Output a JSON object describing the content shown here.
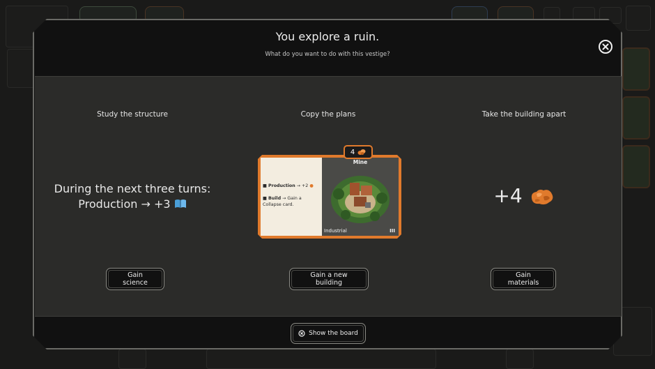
{
  "modal": {
    "title": "You explore a ruin.",
    "subtitle": "What do you want to do with this vestige?"
  },
  "options": [
    {
      "title": "Study the structure",
      "effect_line1": "During the next three turns:",
      "effect_line2": "Production → +3",
      "effect_icon": "science-book-icon",
      "button": "Gain science"
    },
    {
      "title": "Copy the plans",
      "button": "Gain a new building",
      "card": {
        "cost": "4",
        "cost_icon": "materials-icon",
        "name": "Mine",
        "production_label": "Production",
        "production_value": "→ +2",
        "build_label": "Build",
        "build_text": "→ Gain a Collapse card.",
        "type": "Industrial",
        "tier": "III"
      }
    },
    {
      "title": "Take the building apart",
      "effect": "+4",
      "effect_icon": "materials-icon",
      "button": "Gain materials"
    }
  ],
  "footer": {
    "show_board_label": "Show the board",
    "show_board_icon": "close-circle-icon"
  },
  "colors": {
    "accent_orange": "#e07a2c",
    "science_blue": "#4a9fd8",
    "panel_bg": "#2b2b29",
    "header_bg": "#111111"
  }
}
